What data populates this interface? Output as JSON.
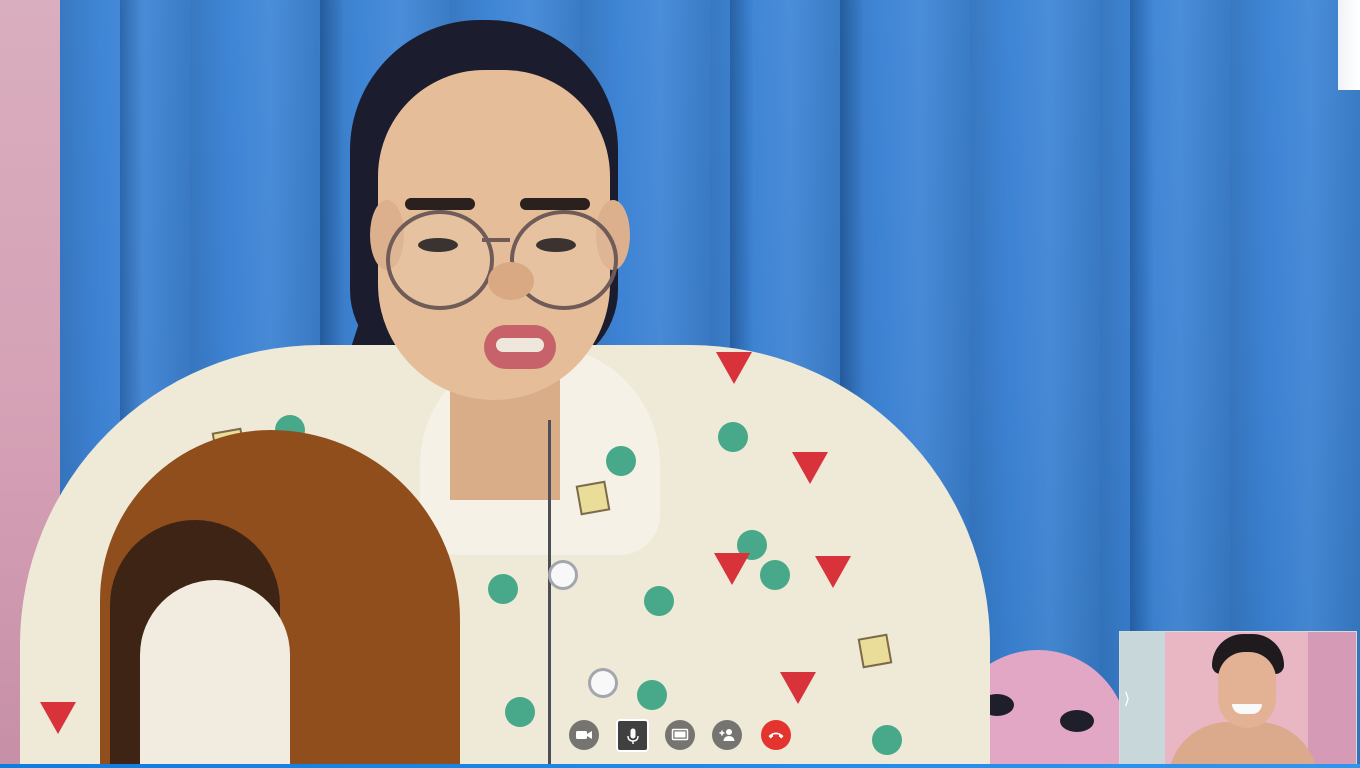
{
  "call": {
    "background_color": "#3f86d6",
    "accent_color": "#0d7de0",
    "controls": [
      {
        "key": "video",
        "icon": "video-camera-icon",
        "state": "on"
      },
      {
        "key": "microphone",
        "icon": "microphone-icon",
        "state": "active"
      },
      {
        "key": "screen_share",
        "icon": "screen-share-icon",
        "state": "off"
      },
      {
        "key": "add_participant",
        "icon": "add-person-icon",
        "state": "off"
      },
      {
        "key": "end_call",
        "icon": "phone-hangup-icon",
        "color": "#e3342f"
      }
    ],
    "self_view": {
      "expand_icon": "chevron-right-icon",
      "expand_glyph": "⟩"
    }
  }
}
